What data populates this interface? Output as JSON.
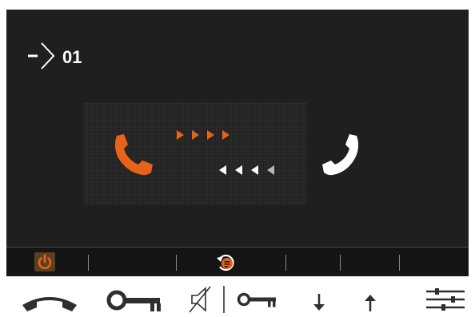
{
  "status": {
    "channel_label": "01"
  },
  "icons": {
    "channel": "arrow-right-icon",
    "caller": "phone-handset-icon",
    "callee": "phone-handset-icon",
    "power": "power-icon",
    "call_log": "call-log-icon"
  },
  "physical_buttons": [
    {
      "name": "hang-up-button",
      "icon": "hang-up-icon"
    },
    {
      "name": "door-key-button",
      "icon": "key-icon"
    },
    {
      "name": "mute-button",
      "icon": "speaker-mute-icon"
    },
    {
      "name": "second-key-button",
      "icon": "key-icon"
    },
    {
      "name": "volume-down-button",
      "icon": "arrow-down-icon"
    },
    {
      "name": "volume-up-button",
      "icon": "arrow-up-icon"
    },
    {
      "name": "menu-button",
      "icon": "settings-sliders-icon"
    }
  ],
  "colors": {
    "screen_bg": "#1f1f1f",
    "accent": "#e8631a",
    "foreground": "#ffffff",
    "physical_icons": "#2f2f2f"
  }
}
